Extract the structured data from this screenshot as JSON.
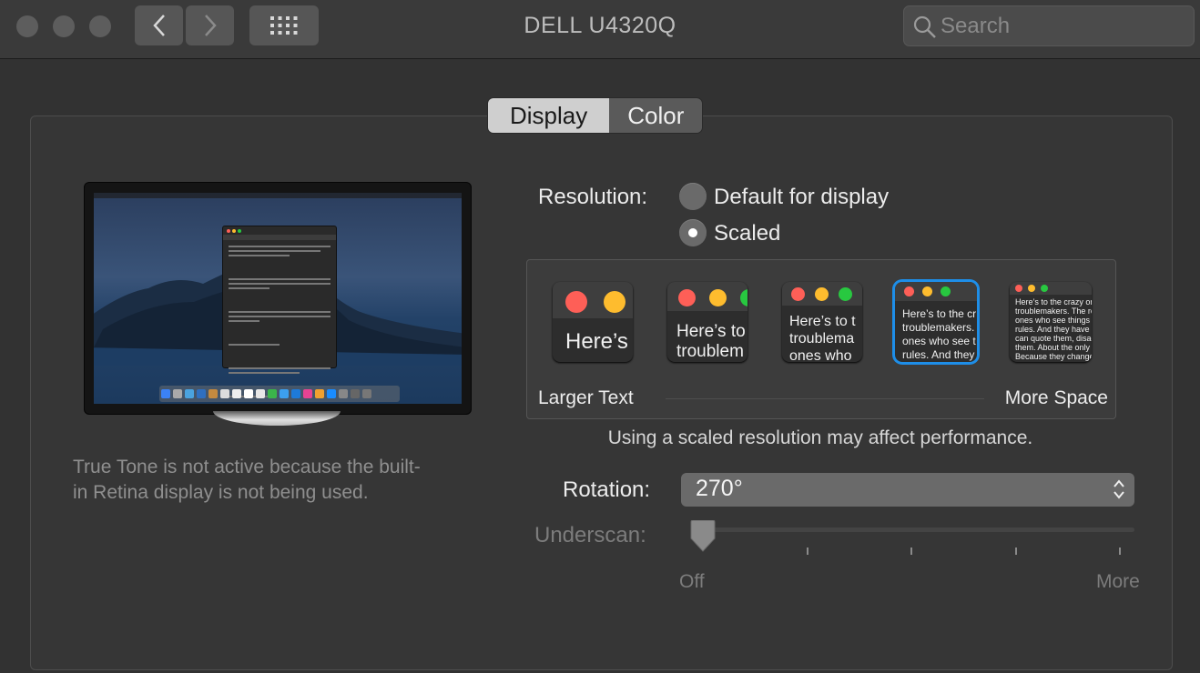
{
  "window": {
    "title": "DELL U4320Q",
    "search_placeholder": "Search"
  },
  "tabs": [
    {
      "label": "Display",
      "selected": true
    },
    {
      "label": "Color",
      "selected": false
    }
  ],
  "true_tone_note": "True Tone is not active because the built-in Retina display is not being used.",
  "true_tone_line1": "True Tone is not active because the built-",
  "true_tone_line2": "in Retina display is not being used.",
  "resolution": {
    "label": "Resolution:",
    "options": [
      {
        "label": "Default for display",
        "selected": false
      },
      {
        "label": "Scaled",
        "selected": true
      }
    ]
  },
  "scaled": {
    "thumbnails": [
      {
        "text": "Here’s"
      },
      {
        "text": "Here’s to\ntroublem"
      },
      {
        "text": "Here’s to t\ntroublema\nones who"
      },
      {
        "text": "Here’s to the cr\ntroublemakers.\nones who see t\nrules. And they"
      },
      {
        "text": "Here’s to the crazy ones\ntroublemakers. The rou\nones who see things dif\nrules. And they have no\ncan quote them, disagre\nthem. About the only th\nBecause they change th"
      }
    ],
    "selected_index": 3,
    "left_label": "Larger Text",
    "right_label": "More Space"
  },
  "performance_note": "Using a scaled resolution may affect performance.",
  "rotation": {
    "label": "Rotation:",
    "value": "270°"
  },
  "underscan": {
    "label": "Underscan:",
    "min_label": "Off",
    "max_label": "More",
    "value": 0
  },
  "colors": {
    "close": "#fe5f57",
    "minimize": "#febc2e",
    "zoom": "#28c840",
    "selection_accent": "#1e8ee8"
  }
}
